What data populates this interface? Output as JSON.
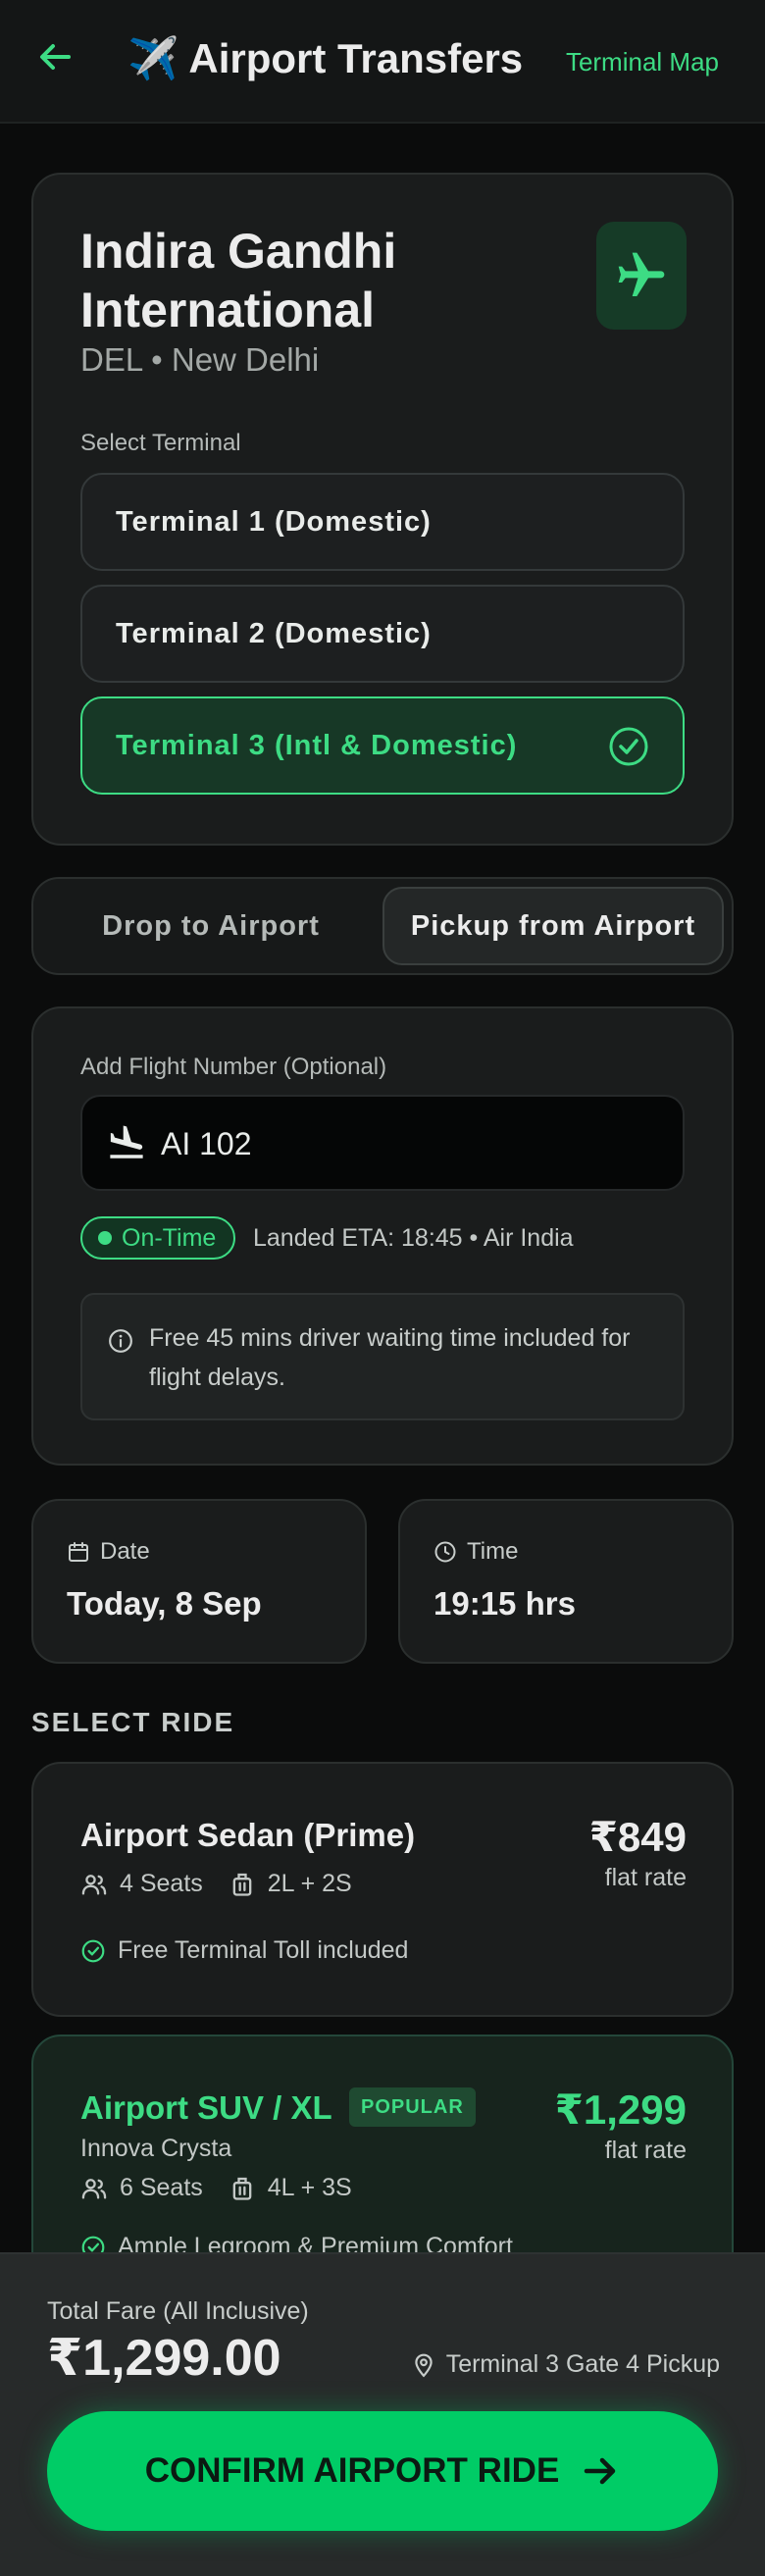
{
  "header": {
    "title": "✈️ Airport Transfers",
    "map_link": "Terminal Map"
  },
  "airport": {
    "name": "Indira Gandhi International",
    "code_city": "DEL • New Delhi",
    "select_label": "Select Terminal",
    "terminals": [
      {
        "label": "Terminal 1 (Domestic)",
        "selected": false
      },
      {
        "label": "Terminal 2 (Domestic)",
        "selected": false
      },
      {
        "label": "Terminal 3 (Intl & Domestic)",
        "selected": true
      }
    ]
  },
  "mode": {
    "drop": "Drop to Airport",
    "pickup": "Pickup from Airport",
    "active": "pickup"
  },
  "flight": {
    "label": "Add Flight Number (Optional)",
    "value": "AI 102",
    "status": "On-Time",
    "eta": "Landed ETA: 18:45 • Air India",
    "info": "Free 45 mins driver waiting time included for flight delays."
  },
  "schedule": {
    "date_label": "Date",
    "date_value": "Today, 8 Sep",
    "time_label": "Time",
    "time_value": "19:15 hrs"
  },
  "rides_title": "SELECT RIDE",
  "rides": [
    {
      "name": "Airport Sedan (Prime)",
      "seats": "4 Seats",
      "luggage": "2L + 2S",
      "price": "₹849",
      "unit": "flat rate",
      "feature": "Free Terminal Toll included"
    },
    {
      "name": "Airport SUV / XL",
      "badge": "POPULAR",
      "model": "Innova Crysta",
      "seats": "6 Seats",
      "luggage": "4L + 3S",
      "price": "₹1,299",
      "unit": "flat rate",
      "feature": "Ample Legroom & Premium Comfort"
    }
  ],
  "footer": {
    "fare_label": "Total Fare (All Inclusive)",
    "fare_value": "₹1,299.00",
    "pickup": "Terminal 3 Gate 4 Pickup",
    "confirm": "CONFIRM AIRPORT RIDE"
  },
  "colors": {
    "accent": "#3ddc84",
    "cta": "#00cc66",
    "background": "#0b0c0c",
    "card": "#1a1c1c"
  }
}
